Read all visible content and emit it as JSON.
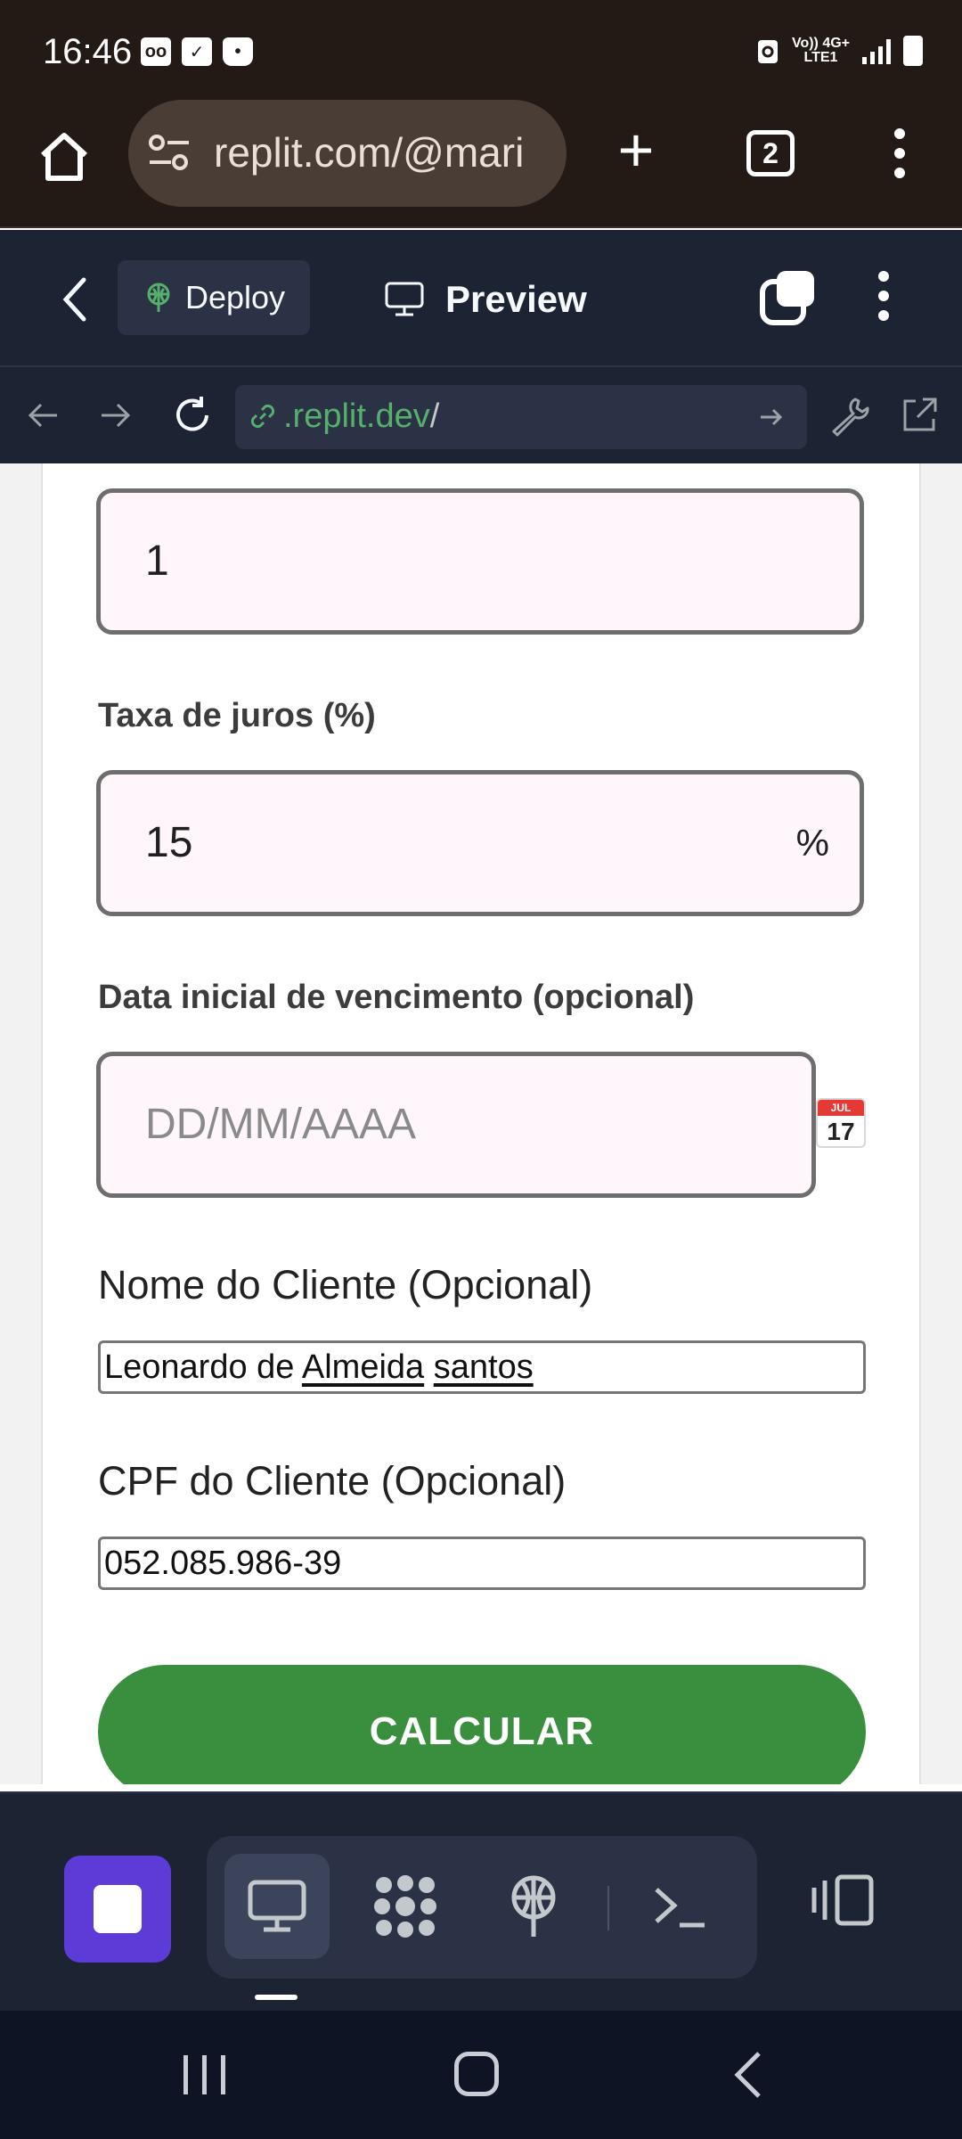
{
  "status_bar": {
    "time": "16:46",
    "network": "Vo)) 4G+",
    "network_sub": "LTE1"
  },
  "browser": {
    "url": "replit.com/@mari",
    "tab_count": "2"
  },
  "replit": {
    "deploy_label": "Deploy",
    "preview_label": "Preview",
    "preview_url_domain": ".replit.dev",
    "preview_url_path": "/"
  },
  "form": {
    "period_value": "1",
    "interest_label": "Taxa de juros (%)",
    "interest_value": "15",
    "interest_suffix": "%",
    "due_date_label": "Data inicial de vencimento (opcional)",
    "due_date_placeholder": "DD/MM/AAAA",
    "calendar_month": "JUL",
    "calendar_day": "17",
    "client_name_label": "Nome do Cliente (Opcional)",
    "client_name_parts": [
      "Leonardo de ",
      "Almeida",
      " ",
      "santos"
    ],
    "client_cpf_label": "CPF do Cliente (Opcional)",
    "client_cpf_value": "052.085.986-39",
    "calculate_label": "CALCULAR"
  },
  "colors": {
    "accent_green": "#3a8f3e",
    "replit_bg": "#1c2333",
    "stop_purple": "#5d3bd6",
    "field_bg": "#fff6fc"
  },
  "icons": [
    "home-icon",
    "tune-icon",
    "plus-icon",
    "tabs-icon",
    "more-icon",
    "chevron-left-icon",
    "deploy-icon",
    "monitor-icon",
    "windows-icon",
    "arrow-left-icon",
    "arrow-right-icon",
    "reload-icon",
    "link-icon",
    "wrench-icon",
    "open-external-icon",
    "calendar-icon",
    "stop-icon",
    "packages-icon",
    "deploy-globe-icon",
    "terminal-icon",
    "panel-icon"
  ]
}
